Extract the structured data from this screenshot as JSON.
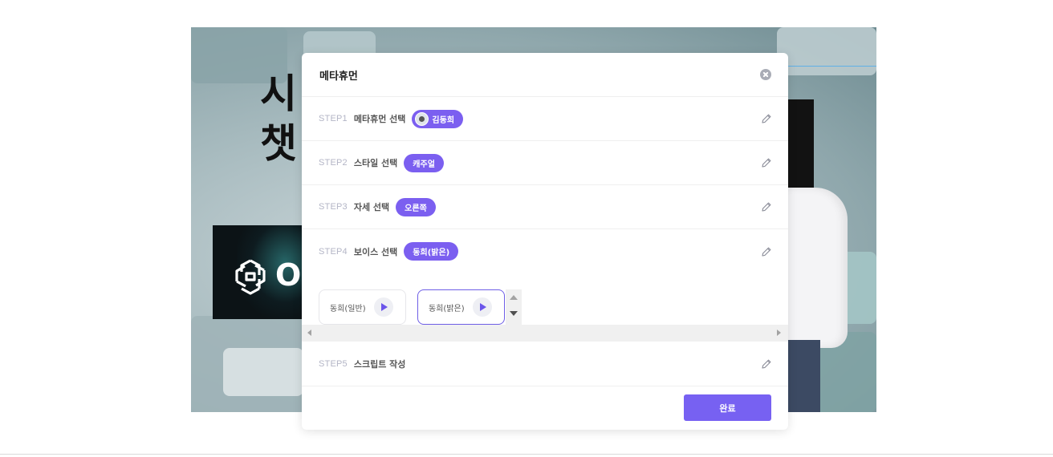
{
  "background": {
    "headline_line1": "시",
    "headline_line2": "챗",
    "logo_text": "O"
  },
  "modal": {
    "title": "메타휴먼",
    "close_icon": "close-circle-icon",
    "steps": [
      {
        "label": "STEP1",
        "title": "메타휴먼 선택",
        "chip": "김동희",
        "has_avatar": true
      },
      {
        "label": "STEP2",
        "title": "스타일 선택",
        "chip": "캐주얼"
      },
      {
        "label": "STEP3",
        "title": "자세 선택",
        "chip": "오른쪽"
      },
      {
        "label": "STEP4",
        "title": "보이스 선택",
        "chip": "동희(밝은)"
      },
      {
        "label": "STEP5",
        "title": "스크립트 작성",
        "chip": ""
      }
    ],
    "voices": [
      {
        "name": "동희(일반)",
        "selected": false
      },
      {
        "name": "동희(밝은)",
        "selected": true
      }
    ],
    "done_label": "완료"
  },
  "colors": {
    "accent": "#7761f2",
    "chip": "#7b5ff0",
    "step_label": "#b3b5c6"
  }
}
